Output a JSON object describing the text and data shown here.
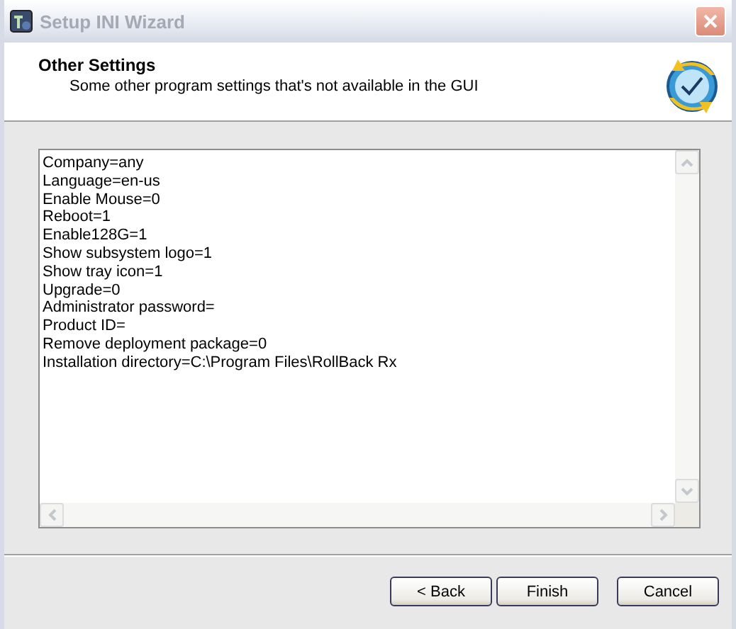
{
  "window": {
    "title": "Setup INI Wizard"
  },
  "header": {
    "title": "Other Settings",
    "subtitle": "Some other program settings that's not available in the GUI"
  },
  "editor": {
    "lines": [
      "Company=any",
      "Language=en-us",
      "Enable Mouse=0",
      "Reboot=1",
      "Enable128G=1",
      "Show subsystem logo=1",
      "Show tray icon=1",
      "Upgrade=0",
      "Administrator password=",
      "Product ID=",
      "Remove deployment package=0",
      "Installation directory=C:\\Program Files\\RollBack Rx"
    ]
  },
  "buttons": [
    {
      "label": "< Back"
    },
    {
      "label": "Finish"
    },
    {
      "label": "Cancel"
    }
  ]
}
